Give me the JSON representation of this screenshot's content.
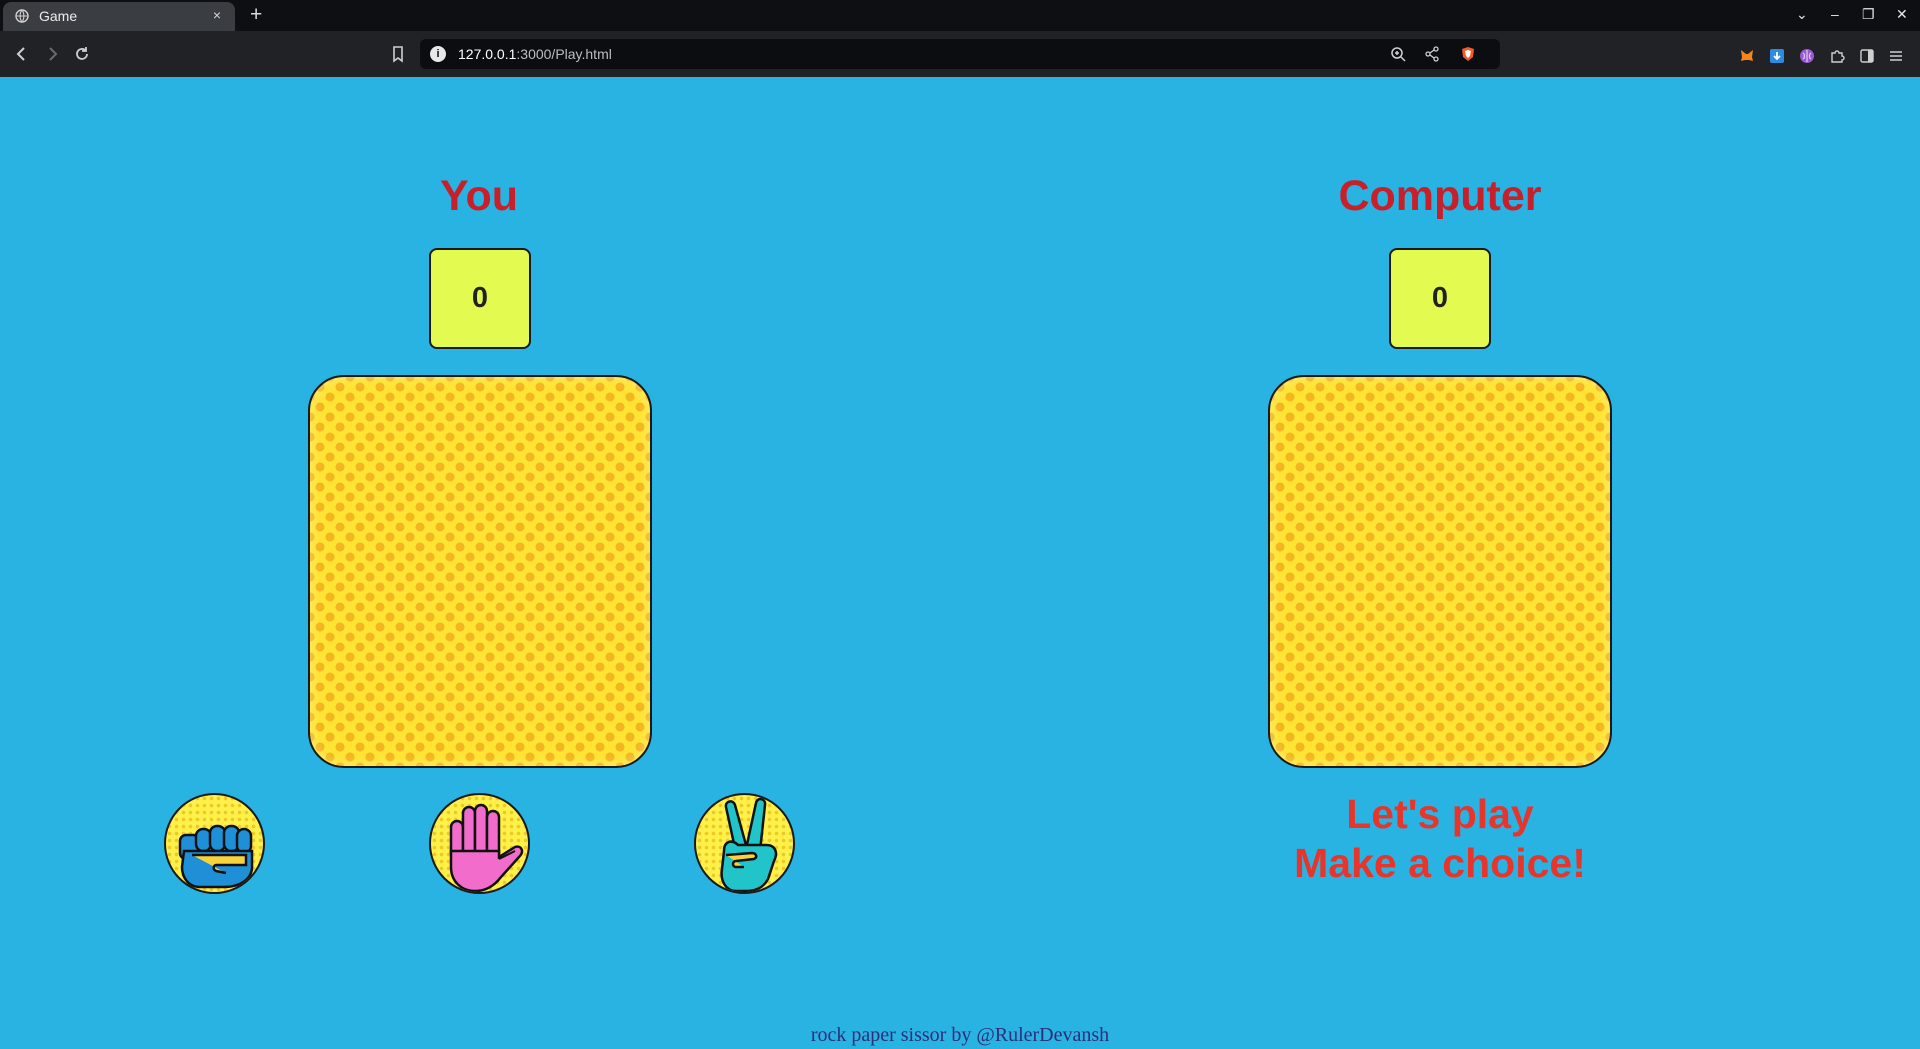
{
  "browser": {
    "tab_title": "Game",
    "tab_close": "×",
    "new_tab": "+",
    "url_host": "127.0.0.1",
    "url_rest": ":3000/Play.html",
    "window_controls": [
      "⌄",
      "–",
      "❐",
      "✕"
    ]
  },
  "game": {
    "player": {
      "title": "You",
      "score": "0"
    },
    "computer": {
      "title": "Computer",
      "score": "0"
    },
    "choices": [
      {
        "name": "rock",
        "icon": "fist-icon"
      },
      {
        "name": "paper",
        "icon": "open-hand-icon"
      },
      {
        "name": "scissors",
        "icon": "peace-hand-icon"
      }
    ],
    "message_line1": "Let's play",
    "message_line2": "Make a choice!"
  },
  "footer": {
    "credit": "rock paper sissor by @RulerDevansh"
  },
  "colors": {
    "page_bg": "#28b3e3",
    "title_red": "#c8202a",
    "message_red": "#e8352b",
    "score_bg": "#e3fb50",
    "card_yellow": "#ffe433",
    "card_dots": "#f4b61e"
  }
}
